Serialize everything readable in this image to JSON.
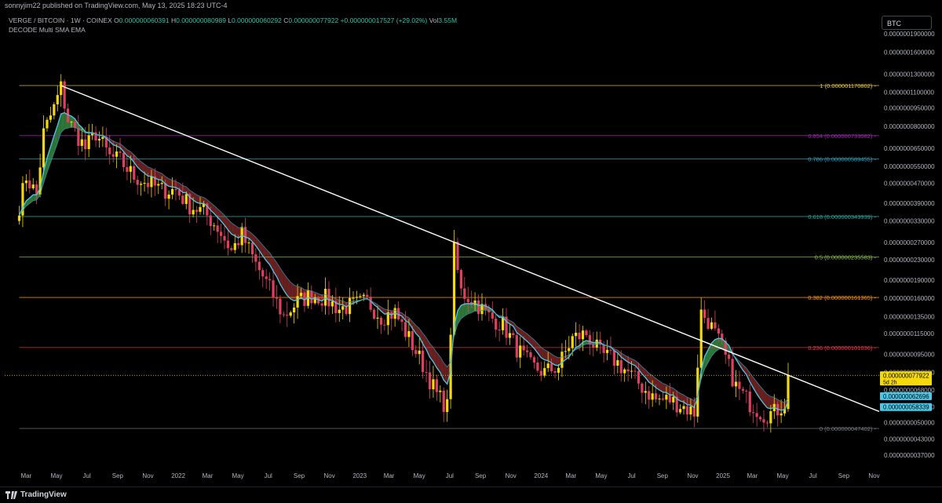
{
  "header": {
    "published": "sonnyjim22 published on TradingView.com, May 13, 2025 18:23 UTC-4"
  },
  "legend": {
    "symbol": "VERGE / BITCOIN · 1W · COINEX",
    "open_label": "O",
    "open": "0.000000060391",
    "high_label": "H",
    "high": "0.000000080989",
    "low_label": "L",
    "low": "0.000000060292",
    "close_label": "C",
    "close": "0.000000077922",
    "change": "+0.000000017527 (+29.02%)",
    "vol_label": "Vol",
    "vol": "3.55M",
    "indicator": "DECODE Multi SMA EMA"
  },
  "currency_button": "BTC",
  "footer": {
    "brand": "TradingView"
  },
  "colors": {
    "up": "#f5d90a",
    "down": "#e04060",
    "ema": "#4dc8e8",
    "bull_fill": "#3d9e4a",
    "bear_fill": "#8a2a2a",
    "trendline": "#ffffff"
  },
  "chart_data": {
    "type": "candlestick",
    "scale": "log",
    "ylim": [
      3.5e-08,
      2e-06
    ],
    "y_ticks": [
      "0.0000001900000",
      "0.0000001600000",
      "0.0000001300000",
      "0.0000001100000",
      "0.0000000950000",
      "0.0000000800000",
      "0.0000000650000",
      "0.0000000550000",
      "0.0000000470000",
      "0.0000000390000",
      "0.0000000330000",
      "0.0000000270000",
      "0.0000000230000",
      "0.0000000190000",
      "0.0000000160000",
      "0.0000000135000",
      "0.0000000115000",
      "0.0000000095000",
      "0.0000000080000",
      "0.0000000068000",
      "0.0000000058000",
      "0.0000000050000",
      "0.0000000043000",
      "0.0000000037000"
    ],
    "y_tick_values": [
      1.9e-06,
      1.6e-06,
      1.3e-06,
      1.1e-06,
      9.5e-07,
      8e-07,
      6.5e-07,
      5.5e-07,
      4.7e-07,
      3.9e-07,
      3.3e-07,
      2.7e-07,
      2.3e-07,
      1.9e-07,
      1.6e-07,
      1.35e-07,
      1.15e-07,
      9.5e-08,
      8e-08,
      6.8e-08,
      5.8e-08,
      5e-08,
      4.3e-08,
      3.7e-08
    ],
    "x_ticks": [
      "Mar",
      "May",
      "Jul",
      "Sep",
      "Nov",
      "2022",
      "Mar",
      "May",
      "Jul",
      "Sep",
      "Nov",
      "2023",
      "Mar",
      "May",
      "Jul",
      "Sep",
      "Nov",
      "2024",
      "Mar",
      "May",
      "Jul",
      "Sep",
      "Nov",
      "2025",
      "Mar",
      "May",
      "Jul",
      "Sep",
      "Nov"
    ],
    "x_tick_dates": [
      "2021-03-01",
      "2021-05-01",
      "2021-07-01",
      "2021-09-01",
      "2021-11-01",
      "2022-01-01",
      "2022-03-01",
      "2022-05-01",
      "2022-07-01",
      "2022-09-01",
      "2022-11-01",
      "2023-01-01",
      "2023-03-01",
      "2023-05-01",
      "2023-07-01",
      "2023-09-01",
      "2023-11-01",
      "2024-01-01",
      "2024-03-01",
      "2024-05-01",
      "2024-07-01",
      "2024-09-01",
      "2024-11-01",
      "2025-01-01",
      "2025-03-01",
      "2025-05-01",
      "2025-07-01",
      "2025-09-01",
      "2025-11-01"
    ],
    "fib_levels": [
      {
        "label": "1 (0.000001170802)",
        "value": 1.170802e-06,
        "color": "#e6c83a"
      },
      {
        "label": "0.854 (0.000000733082)",
        "value": 7.33082e-07,
        "color": "#9c27b0"
      },
      {
        "label": "0.786 (0.000000589455)",
        "value": 5.89455e-07,
        "color": "#26a6c9"
      },
      {
        "label": "0.618 (0.000000343939)",
        "value": 3.43939e-07,
        "color": "#26a69a"
      },
      {
        "label": "0.5 (0.000000235583)",
        "value": 2.35583e-07,
        "color": "#8bc34a"
      },
      {
        "label": "0.382 (0.000000161365)",
        "value": 1.61365e-07,
        "color": "#ff9800"
      },
      {
        "label": "0.236 (0.000000101036)",
        "value": 1.01036e-07,
        "color": "#f23645"
      },
      {
        "label": "0 (0.000000047402)",
        "value": 4.7402e-08,
        "color": "#787b86"
      }
    ],
    "price_labels": [
      {
        "text": "0.000000077922",
        "sub": "5d 2h",
        "value": 7.7922e-08,
        "bg": "#f5d90a",
        "fg": "#000000"
      },
      {
        "text": "0.000000062696",
        "value": 6.2696e-08,
        "bg": "#4dc8e8",
        "fg": "#000000"
      },
      {
        "text": "0.000000058339",
        "value": 5.8339e-08,
        "bg": "#4dc8e8",
        "fg": "#000000"
      }
    ],
    "trendline": {
      "from": {
        "date": "2021-05-10",
        "value": 1.17e-06
      },
      "to": {
        "date": "2025-05-12",
        "value": 7.8e-08
      },
      "extends": true
    },
    "last_close": 7.7922e-08,
    "close_path": [
      [
        "2021-02-15",
        3.8e-07
      ],
      [
        "2021-03-01",
        5e-07
      ],
      [
        "2021-03-22",
        4.2e-07
      ],
      [
        "2021-04-05",
        7.5e-07
      ],
      [
        "2021-04-26",
        9.5e-07
      ],
      [
        "2021-05-10",
        1.15e-06
      ],
      [
        "2021-05-24",
        8.5e-07
      ],
      [
        "2021-06-07",
        7.6e-07
      ],
      [
        "2021-06-28",
        6.5e-07
      ],
      [
        "2021-07-19",
        7.5e-07
      ],
      [
        "2021-08-16",
        6e-07
      ],
      [
        "2021-09-06",
        5.8e-07
      ],
      [
        "2021-10-04",
        5e-07
      ],
      [
        "2021-11-01",
        4.7e-07
      ],
      [
        "2021-11-29",
        4.4e-07
      ],
      [
        "2021-12-27",
        4.4e-07
      ],
      [
        "2022-01-24",
        3.8e-07
      ],
      [
        "2022-02-21",
        3.6e-07
      ],
      [
        "2022-03-21",
        3.1e-07
      ],
      [
        "2022-04-18",
        2.5e-07
      ],
      [
        "2022-05-09",
        2.9e-07
      ],
      [
        "2022-06-06",
        2.2e-07
      ],
      [
        "2022-07-04",
        1.75e-07
      ],
      [
        "2022-08-01",
        1.35e-07
      ],
      [
        "2022-08-29",
        1.55e-07
      ],
      [
        "2022-09-26",
        1.65e-07
      ],
      [
        "2022-10-24",
        1.6e-07
      ],
      [
        "2022-11-21",
        1.45e-07
      ],
      [
        "2022-12-19",
        1.5e-07
      ],
      [
        "2023-01-16",
        1.55e-07
      ],
      [
        "2023-02-13",
        1.35e-07
      ],
      [
        "2023-03-13",
        1.4e-07
      ],
      [
        "2023-04-10",
        1.1e-07
      ],
      [
        "2023-05-08",
        8.6e-08
      ],
      [
        "2023-06-05",
        6.5e-08
      ],
      [
        "2023-06-26",
        5.8e-08
      ],
      [
        "2023-07-10",
        2.5e-07
      ],
      [
        "2023-07-24",
        1.7e-07
      ],
      [
        "2023-08-21",
        1.55e-07
      ],
      [
        "2023-09-18",
        1.35e-07
      ],
      [
        "2023-10-16",
        1.25e-07
      ],
      [
        "2023-11-13",
        1e-07
      ],
      [
        "2023-12-11",
        8.5e-08
      ],
      [
        "2024-01-08",
        8e-08
      ],
      [
        "2024-02-05",
        8.5e-08
      ],
      [
        "2024-03-04",
        1.1e-07
      ],
      [
        "2024-04-01",
        1.15e-07
      ],
      [
        "2024-04-29",
        9.5e-08
      ],
      [
        "2024-05-27",
        9e-08
      ],
      [
        "2024-06-24",
        8e-08
      ],
      [
        "2024-07-22",
        7e-08
      ],
      [
        "2024-08-19",
        6.2e-08
      ],
      [
        "2024-09-16",
        6.2e-08
      ],
      [
        "2024-10-14",
        5.8e-08
      ],
      [
        "2024-11-04",
        5.5e-08
      ],
      [
        "2024-11-18",
        1.4e-07
      ],
      [
        "2024-12-02",
        1.3e-07
      ],
      [
        "2024-12-30",
        1e-07
      ],
      [
        "2025-01-27",
        7e-08
      ],
      [
        "2025-02-24",
        6e-08
      ],
      [
        "2025-03-24",
        5.4e-08
      ],
      [
        "2025-04-14",
        5.5e-08
      ],
      [
        "2025-05-05",
        6e-08
      ],
      [
        "2025-05-12",
        7.79e-08
      ]
    ]
  }
}
